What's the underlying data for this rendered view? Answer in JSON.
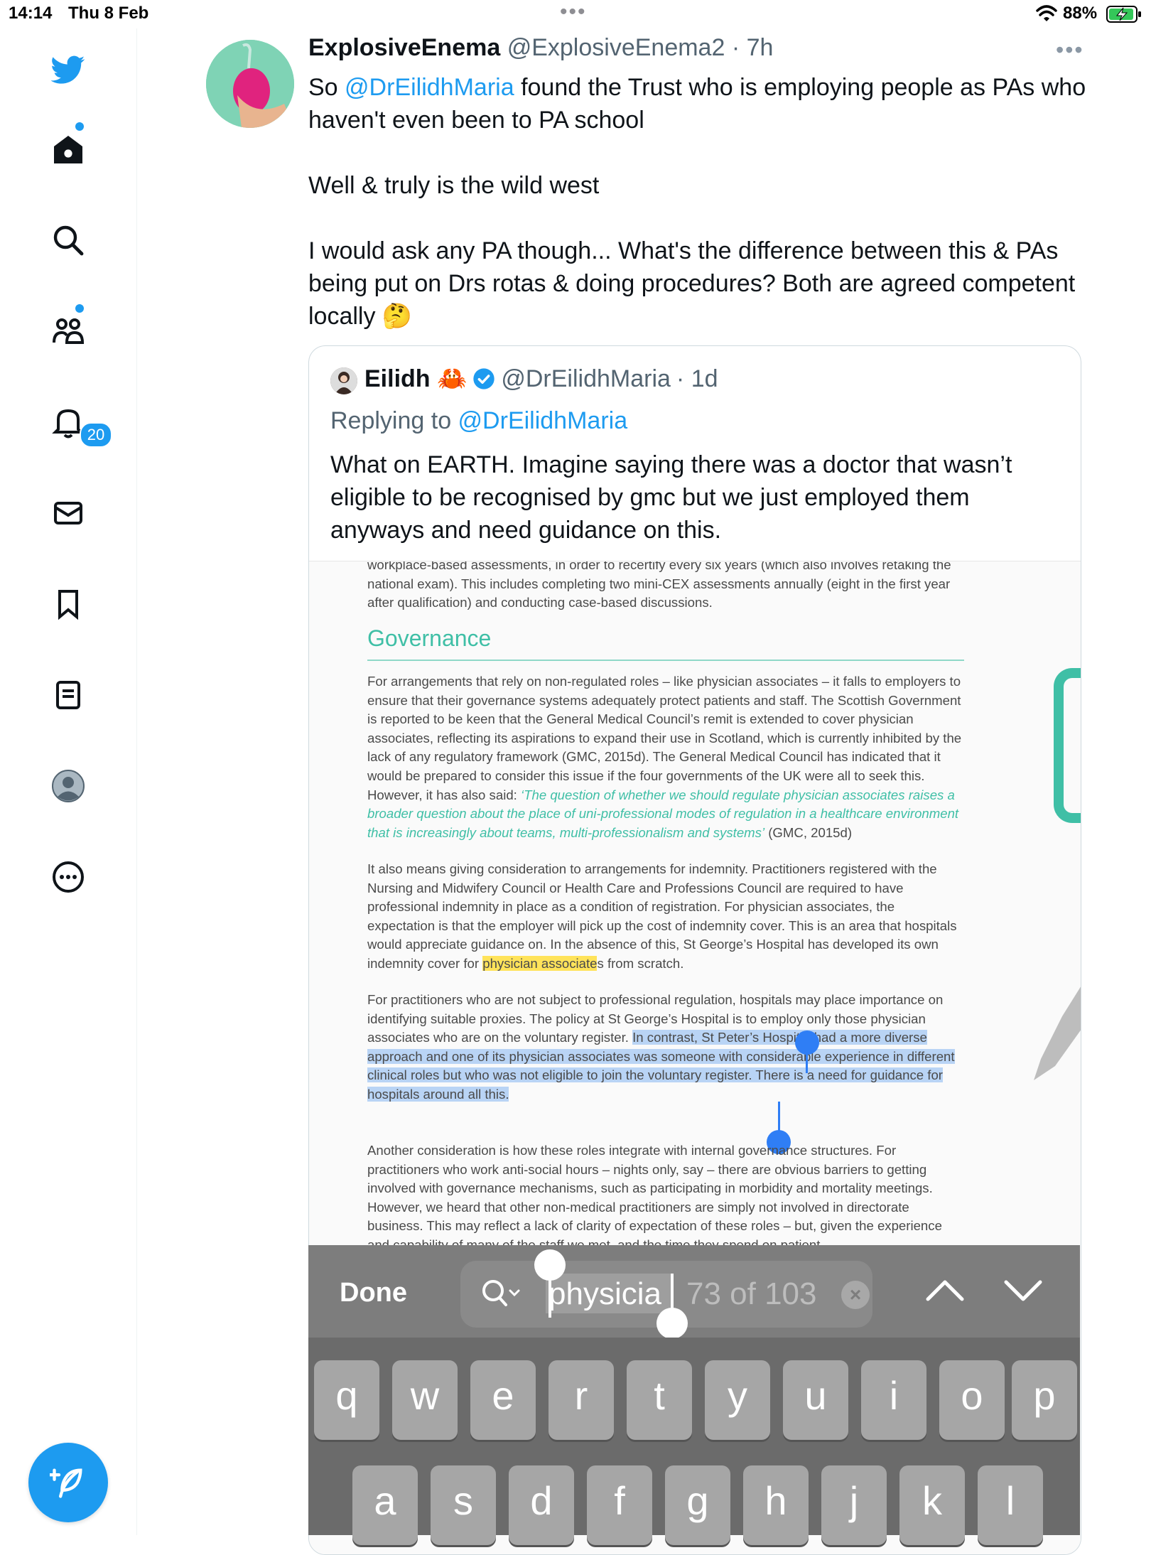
{
  "status_bar": {
    "time": "14:14",
    "date": "Thu 8 Feb",
    "battery_percent": "88%",
    "charging": true
  },
  "sidebar": {
    "items": [
      {
        "name": "twitter-logo"
      },
      {
        "name": "home",
        "has_dot": true
      },
      {
        "name": "explore"
      },
      {
        "name": "communities",
        "has_dot": true
      },
      {
        "name": "notifications",
        "badge": "20"
      },
      {
        "name": "messages"
      },
      {
        "name": "bookmarks"
      },
      {
        "name": "lists"
      },
      {
        "name": "profile"
      },
      {
        "name": "more"
      }
    ],
    "compose_icon": "compose-feather-icon"
  },
  "tweet": {
    "display_name": "ExplosiveEnema",
    "handle": "@ExplosiveEnema2",
    "time": "· 7h",
    "text_line1_pre": "So ",
    "text_mention": "@DrEilidhMaria",
    "text_line1_post": " found the Trust who is employing people as PAs who haven't even been to PA school",
    "text_para2": "Well & truly is the wild west",
    "text_para3": "I would ask any PA though... What's the difference between this & PAs being put on Drs rotas & doing procedures? Both are agreed competent locally 🤔"
  },
  "quoted_tweet": {
    "display_name": "Eilidh 🦀",
    "handle": "@DrEilidhMaria",
    "time": "· 1d",
    "replying_label": "Replying to ",
    "replying_to": "@DrEilidhMaria",
    "text": "What on EARTH. Imagine saying there was a doctor that wasn’t eligible to be recognised by gmc but we just employed them anyways and need guidance on this."
  },
  "document": {
    "top_para": "workplace-based assessments, in order to recertify every six years (which also involves retaking the national exam). This includes completing two mini-CEX assessments annually (eight in the first year after qualification) and conducting case-based discussions.",
    "heading": "Governance",
    "para1_a": "For arrangements that rely on non-regulated roles – like physician associates – it falls to employers to ensure that their governance systems adequately protect patients and staff. The Scottish Government is reported to be keen that the General Medical Council’s remit is extended to cover physician associates, reflecting its aspirations to expand their use in Scotland, which is currently inhibited by the lack of any regulatory framework (GMC, 2015d). The General Medical Council has indicated that it would be prepared to consider this issue if the four governments of the UK were all to seek this. However, it has also said: ",
    "para1_quote": "‘The question of whether we should regulate physician associates raises a broader question about the place of uni-professional modes of regulation in a healthcare environment that is increasingly about teams, multi-professionalism and systems’",
    "para1_b": " (GMC, 2015d)",
    "para2_a": "It also means giving consideration to arrangements for indemnity. Practitioners registered with the Nursing and Midwifery Council or Health Care and Professions Council are required to have professional indemnity in place as a condition of registration. For physician associates, the expectation is that the employer will pick up the cost of indemnity cover. This is an area that hospitals would appreciate guidance on. In the absence of this, St George’s Hospital has developed its own indemnity cover for ",
    "para2_hl": "physician associate",
    "para2_b": "s from scratch.",
    "para3_a": "For practitioners who are not subject to professional regulation, hospitals may place importance on identifying suitable proxies. The policy at St George’s Hospital is to employ only those physician associates who are on the voluntary register. ",
    "para3_sel": "In contrast, St Peter’s Hospital had a more diverse approach and one of its physician associates was someone with considerable experience in different clinical roles but who was not eligible to join the voluntary register. There is a need for guidance for hospitals around all this.",
    "para4": "Another consideration is how these roles integrate with internal governance structures. For practitioners who work anti-social hours – nights only, say – there are obvious barriers to getting involved with governance mechanisms, such as participating in morbidity and mortality meetings. However, we heard that other non-medical practitioners are simply not involved in directorate business. This may reflect a lack of clarity of expectation of these roles – but, given the experience and capability of many of the staff we met, and the time they spend on patient"
  },
  "find_bar": {
    "done_label": "Done",
    "search_term": "physicia",
    "match_count": "73 of 103",
    "clear_icon": "×"
  },
  "keyboard": {
    "row1": [
      "q",
      "w",
      "e",
      "r",
      "t",
      "y",
      "u",
      "i",
      "o",
      "p"
    ],
    "row2": [
      "a",
      "s",
      "d",
      "f",
      "g",
      "h",
      "j",
      "k",
      "l"
    ]
  },
  "colors": {
    "accent": "#1d9bf0",
    "doc_green": "#3fbfa6",
    "highlight_yellow": "#ffe35a",
    "selection_blue": "#b9d4f5"
  }
}
